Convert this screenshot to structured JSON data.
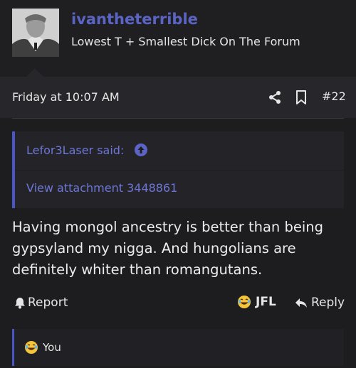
{
  "header": {
    "username": "ivantheterrible",
    "user_title": "Lowest T + Smallest Dick On The Forum"
  },
  "post": {
    "date": "Friday at 10:07 AM",
    "number": "#22",
    "quote": {
      "author_label": "Lefor3Laser said:",
      "body": "View attachment 3448861"
    },
    "text": "Having mongol ancestry is better than being gypsyland my nigga. And hungolians are definitely whiter than romangutans."
  },
  "actions": {
    "report_label": "Report",
    "reaction_label": "JFL",
    "reply_label": "Reply"
  },
  "reactions": {
    "summary": "You"
  },
  "colors": {
    "accent": "#5b64c4",
    "background": "#1d1d20",
    "meta_bar": "#27272b"
  },
  "icons": [
    "share-icon",
    "bookmark-icon",
    "arrow-up-circle-icon",
    "bell-icon",
    "laughing-emoji-icon",
    "reply-arrow-icon"
  ]
}
